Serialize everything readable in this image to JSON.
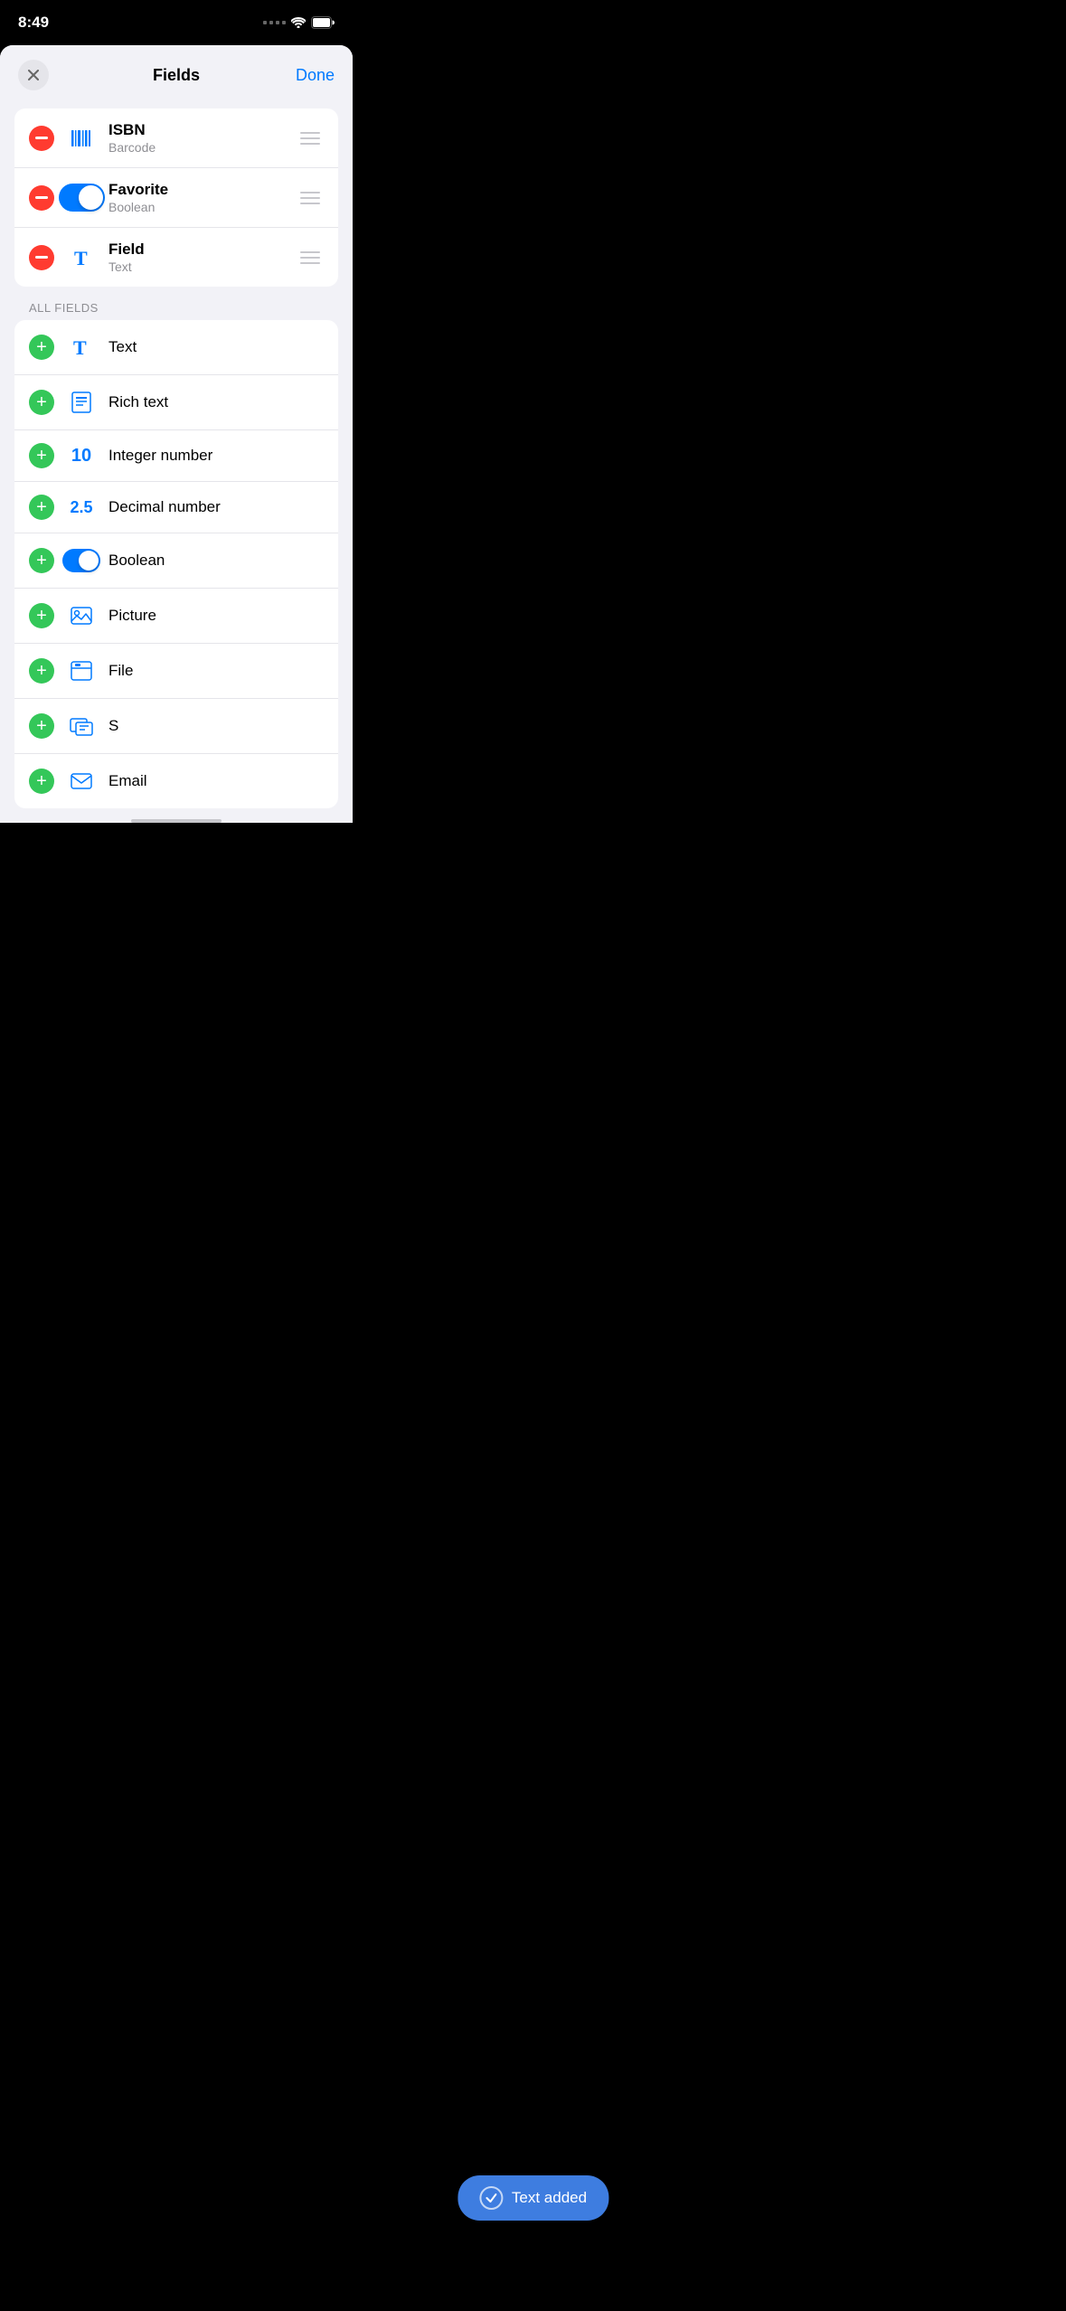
{
  "statusBar": {
    "time": "8:49"
  },
  "nav": {
    "title": "Fields",
    "doneLabel": "Done",
    "closeAriaLabel": "Close"
  },
  "activeFields": [
    {
      "name": "ISBN",
      "type": "Barcode",
      "iconType": "barcode"
    },
    {
      "name": "Favorite",
      "type": "Boolean",
      "iconType": "toggle"
    },
    {
      "name": "Field",
      "type": "Text",
      "iconType": "text"
    }
  ],
  "sectionLabel": "ALL FIELDS",
  "allFields": [
    {
      "name": "Text",
      "iconType": "text"
    },
    {
      "name": "Rich text",
      "iconType": "richtext"
    },
    {
      "name": "Integer number",
      "iconType": "integer"
    },
    {
      "name": "Decimal number",
      "iconType": "decimal"
    },
    {
      "name": "Boolean",
      "iconType": "toggle"
    },
    {
      "name": "Picture",
      "iconType": "picture"
    },
    {
      "name": "File",
      "iconType": "file"
    },
    {
      "name": "S",
      "iconType": "screenshot"
    },
    {
      "name": "Email",
      "iconType": "email"
    }
  ],
  "toast": {
    "message": "Text added"
  }
}
